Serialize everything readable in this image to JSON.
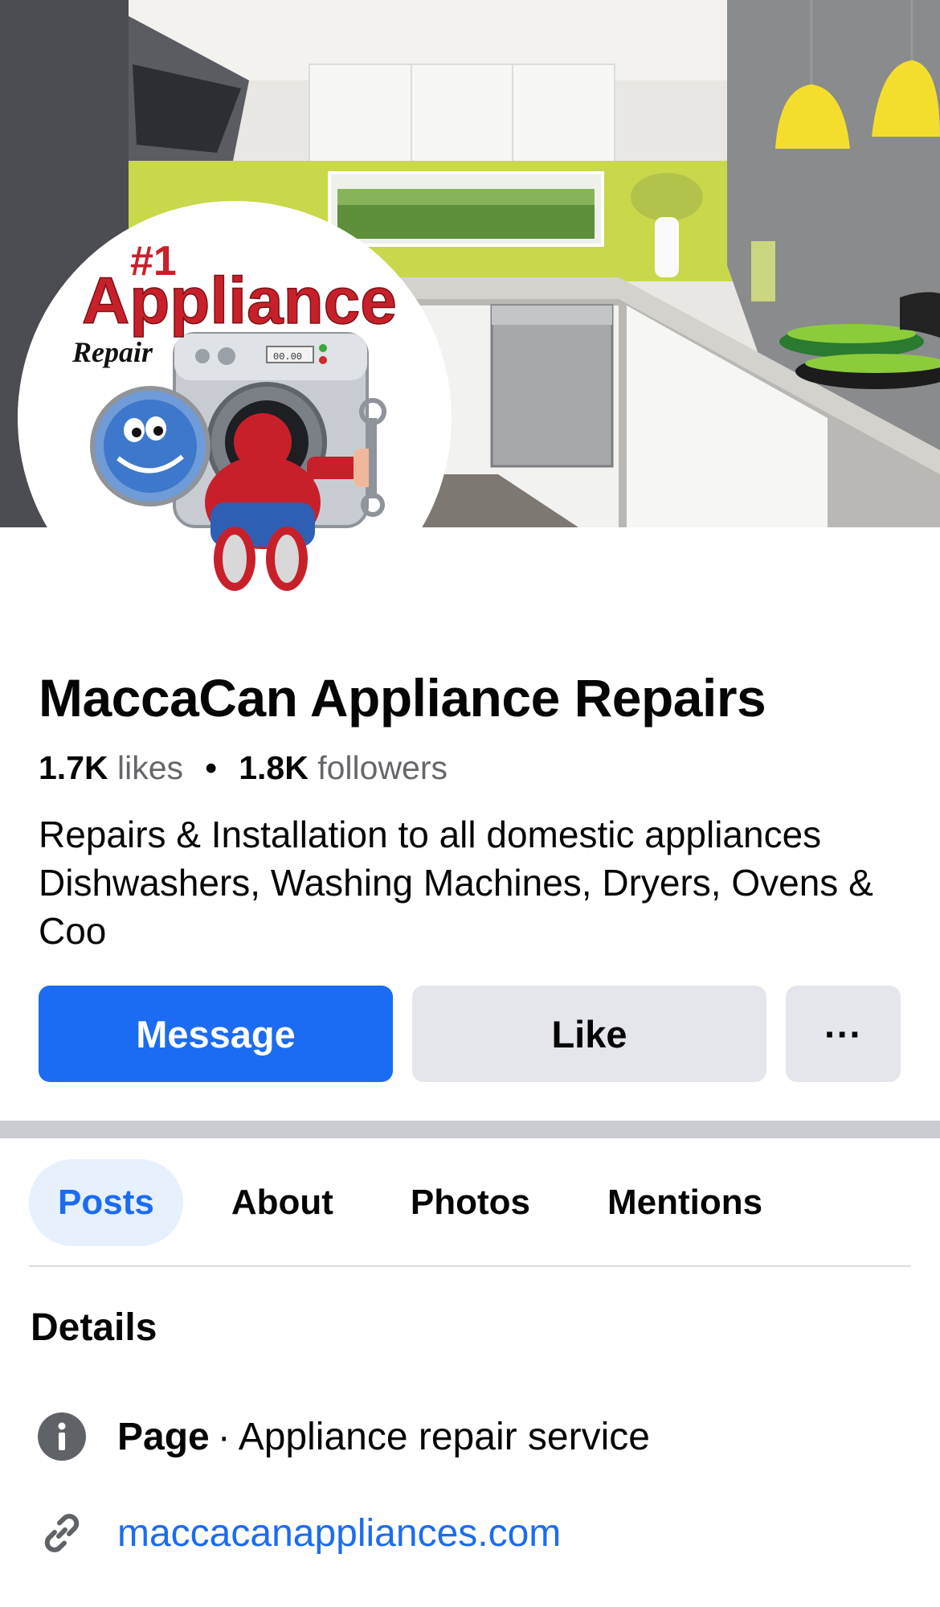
{
  "cover": {
    "alt_icon": "kitchen-cover-photo"
  },
  "logo": {
    "line1": "#1",
    "line2": "Appliance",
    "line3": "Repair",
    "display": "00.00",
    "brand_red": "#c8202a"
  },
  "page": {
    "name": "MaccaCan Appliance Repairs",
    "likes_count": "1.7K",
    "likes_label": "likes",
    "followers_count": "1.8K",
    "followers_label": "followers",
    "separator": "•",
    "bio": "Repairs & Installation to all domestic appliances Dishwashers, Washing Machines, Dryers, Ovens & Coo"
  },
  "actions": {
    "message": "Message",
    "like": "Like",
    "more": "···"
  },
  "tabs": [
    {
      "label": "Posts",
      "active": true
    },
    {
      "label": "About",
      "active": false
    },
    {
      "label": "Photos",
      "active": false
    },
    {
      "label": "Mentions",
      "active": false
    }
  ],
  "details": {
    "title": "Details",
    "category_prefix": "Page",
    "category_sep": "·",
    "category": "Appliance repair service",
    "website": "maccacanappliances.com",
    "icons": {
      "info": "info-icon",
      "link": "link-icon"
    }
  },
  "colors": {
    "accent": "#1b6cf2",
    "button_grey": "#e4e6eb",
    "muted_text": "#65676b"
  }
}
